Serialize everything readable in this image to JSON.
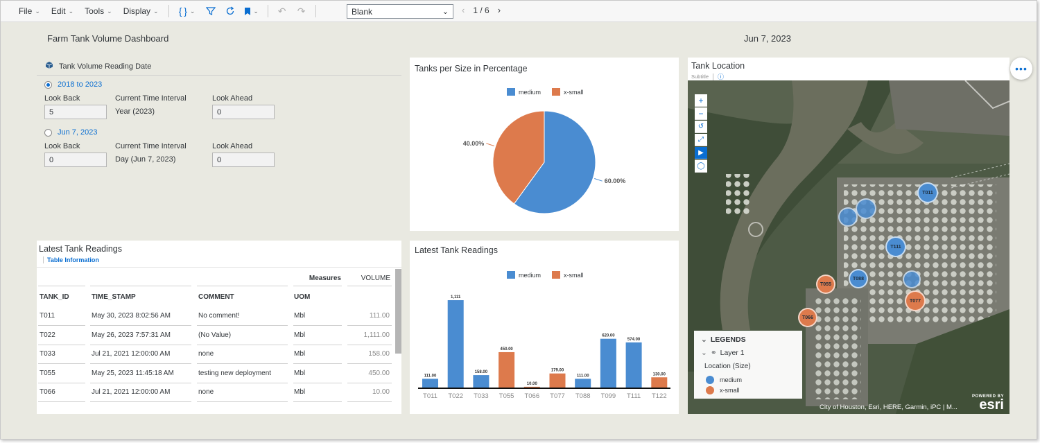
{
  "toolbar": {
    "menus": [
      "File",
      "Edit",
      "Tools",
      "Display"
    ],
    "story_select": "Blank",
    "page_indicator": "1 / 6"
  },
  "page": {
    "title": "Farm Tank Volume Dashboard",
    "date": "Jun 7, 2023"
  },
  "time_control": {
    "title": "Tank Volume Reading Date",
    "options": [
      {
        "label": "2018 to 2023",
        "selected": true,
        "look_back_label": "Look Back",
        "look_back": "5",
        "interval_label": "Current Time Interval",
        "interval": "Year (2023)",
        "look_ahead_label": "Look Ahead",
        "look_ahead": "0"
      },
      {
        "label": "Jun 7, 2023",
        "selected": false,
        "look_back_label": "Look Back",
        "look_back": "0",
        "interval_label": "Current Time Interval",
        "interval": "Day (Jun 7, 2023)",
        "look_ahead_label": "Look Ahead",
        "look_ahead": "0"
      }
    ]
  },
  "pie_card": {
    "title": "Tanks per Size in Percentage",
    "legend": [
      "medium",
      "x-small"
    ]
  },
  "table_card": {
    "title": "Latest Tank Readings",
    "subtitle": "Table Information",
    "measures_label": "Measures",
    "volume_label": "VOLUME",
    "columns": [
      "TANK_ID",
      "TIME_STAMP",
      "COMMENT",
      "UOM"
    ],
    "rows": [
      {
        "tank": "T011",
        "time": "May 30, 2023 8:02:56 AM",
        "comment": "No comment!",
        "uom": "Mbl",
        "volume": "111.00"
      },
      {
        "tank": "T022",
        "time": "May 26, 2023 7:57:31 AM",
        "comment": "(No Value)",
        "uom": "Mbl",
        "volume": "1,111.00"
      },
      {
        "tank": "T033",
        "time": "Jul 21, 2021 12:00:00 AM",
        "comment": "none",
        "uom": "Mbl",
        "volume": "158.00"
      },
      {
        "tank": "T055",
        "time": "May 25, 2023 11:45:18 AM",
        "comment": "testing new deployment",
        "uom": "Mbl",
        "volume": "450.00"
      },
      {
        "tank": "T066",
        "time": "Jul 21, 2021 12:00:00 AM",
        "comment": "none",
        "uom": "Mbl",
        "volume": "10.00"
      }
    ]
  },
  "bar_card": {
    "title": "Latest Tank Readings",
    "legend": [
      "medium",
      "x-small"
    ]
  },
  "map_card": {
    "title": "Tank Location",
    "subtitle": "Subtitle",
    "legend_title": "LEGENDS",
    "layer": "Layer 1",
    "location_label": "Location (Size)",
    "legend_items": [
      "medium",
      "x-small"
    ],
    "credit": "City of Houston, Esri, HERE, Garmin, iPC | M...",
    "powered_by": "POWERED BY",
    "brand": "esri",
    "markers": [
      {
        "label": "T011",
        "size": "medium"
      },
      {
        "label": "T111",
        "size": "medium"
      },
      {
        "label": "T088",
        "size": "medium"
      },
      {
        "label": "T055",
        "size": "x-small"
      },
      {
        "label": "T077",
        "size": "x-small"
      },
      {
        "label": "T066",
        "size": "x-small"
      }
    ]
  },
  "colors": {
    "medium": "#4a8cd1",
    "x_small": "#dd7a4c",
    "accent": "#0a6ed1"
  },
  "chart_data": [
    {
      "type": "pie",
      "title": "Tanks per Size in Percentage",
      "categories": [
        "medium",
        "x-small"
      ],
      "values": [
        60,
        40
      ],
      "labels": [
        "60.00%",
        "40.00%"
      ],
      "legend": "top"
    },
    {
      "type": "bar",
      "title": "Latest Tank Readings",
      "categories": [
        "T011",
        "T022",
        "T033",
        "T055",
        "T066",
        "T077",
        "T088",
        "T099",
        "T111",
        "T122"
      ],
      "values": [
        111,
        1111,
        158,
        450,
        10,
        179,
        111,
        620,
        574,
        130
      ],
      "value_labels": [
        "111.00",
        "1,111",
        "158.00",
        "450.00",
        "10.00",
        "179.00",
        "111.00",
        "620.00",
        "574.00",
        "130.00"
      ],
      "size": [
        "medium",
        "medium",
        "medium",
        "x-small",
        "x-small",
        "x-small",
        "medium",
        "medium",
        "medium",
        "x-small"
      ],
      "series": [
        {
          "name": "medium"
        },
        {
          "name": "x-small"
        }
      ],
      "legend": "top",
      "ylim": [
        0,
        1111
      ]
    }
  ]
}
